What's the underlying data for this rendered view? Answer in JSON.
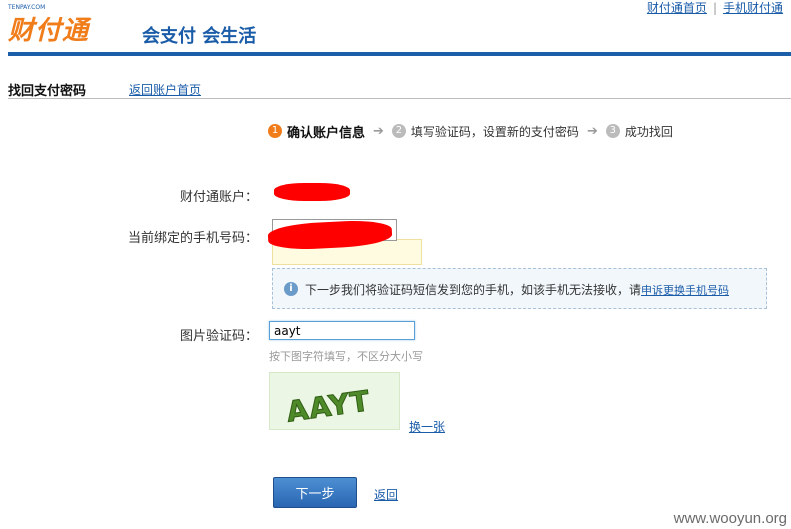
{
  "header": {
    "logo_small": "TENPAY.COM",
    "logo_main": "财付通",
    "slogan": "会支付 会生活",
    "links": [
      "财付通首页",
      "手机财付通"
    ],
    "link_separator": "|"
  },
  "title_bar": {
    "title": "找回支付密码",
    "back_home_link": "返回账户首页"
  },
  "steps": [
    {
      "number": "1",
      "label": "确认账户信息",
      "active": true
    },
    {
      "number": "2",
      "label": "填写验证码，设置新的支付密码",
      "active": false
    },
    {
      "number": "3",
      "label": "成功找回",
      "active": false
    }
  ],
  "step_arrow": "➔",
  "form": {
    "account_label": "财付通账户：",
    "phone_label": "当前绑定的手机号码：",
    "info_icon": "i",
    "info_text": "下一步我们将验证码短信发到您的手机，如该手机无法接收，请",
    "info_link": "申诉更换手机号码",
    "captcha_label": "图片验证码：",
    "captcha_value": "aayt",
    "captcha_hint": "按下图字符填写，不区分大小写",
    "captcha_image_text": "AAYT",
    "refresh_link": "换一张",
    "next_button": "下一步",
    "back_link": "返回"
  },
  "colors": {
    "accent_blue": "#1b5fa8",
    "orange": "#f07c1a",
    "redaction": "#ff0000"
  },
  "watermark": "www.wooyun.org"
}
